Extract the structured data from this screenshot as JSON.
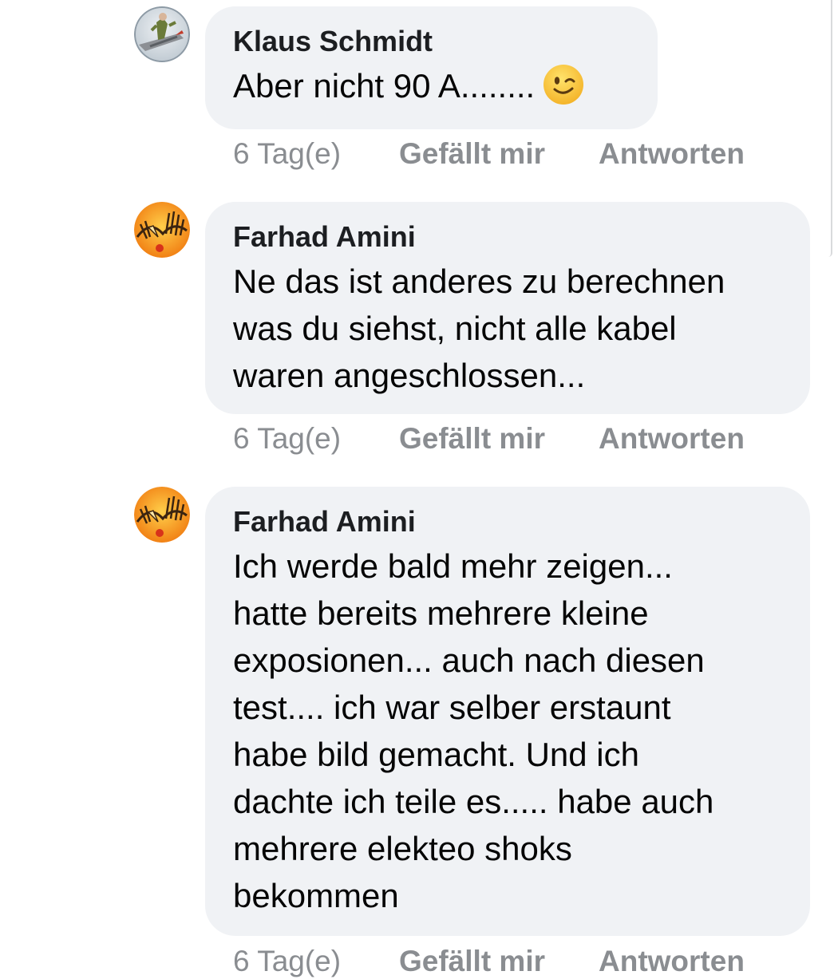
{
  "comments": [
    {
      "author": "Klaus Schmidt",
      "text": "Aber nicht 90 A........",
      "emoji": "winking-face-icon",
      "timestamp": "6 Tag(e)",
      "like_label": "Gefällt mir",
      "reply_label": "Antworten"
    },
    {
      "author": "Farhad Amini",
      "text": "Ne das ist anderes zu berechnen\nwas du siehst, nicht alle kabel\nwaren angeschlossen...",
      "timestamp": "6 Tag(e)",
      "like_label": "Gefällt mir",
      "reply_label": "Antworten"
    },
    {
      "author": "Farhad Amini",
      "text": "Ich werde bald mehr zeigen...\nhatte bereits mehrere kleine\nexposionen... auch nach diesen\ntest.... ich war selber erstaunt\nhabe bild gemacht. Und ich\ndachte ich teile es..... habe auch\nmehrere elekteo shoks\nbekommen",
      "timestamp": "6 Tag(e)",
      "like_label": "Gefällt mir",
      "reply_label": "Antworten"
    }
  ],
  "colors": {
    "bubble": "#f0f2f5",
    "meta_text": "#8a8d91",
    "body_text": "#050505"
  }
}
